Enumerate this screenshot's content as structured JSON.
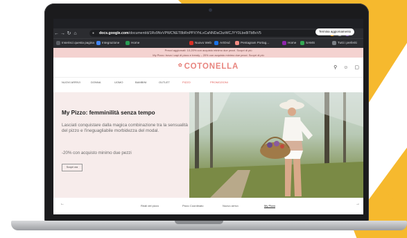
{
  "browser": {
    "url_domain": "docs.google.com",
    "url_rest": "/document/d/1Rv9NvVPWCNET8bRnPPXYhLxCaNNDaCbzWCJYY0Lbe8iTbBvV5",
    "update_button": "Termina aggiornamento",
    "bookmarks": [
      {
        "label": "Inserisci questa pagina",
        "color": "#5a5d63"
      },
      {
        "label": "Integrazione",
        "color": "#4285f4"
      },
      {
        "label": "Home",
        "color": "#2a9d54"
      },
      {
        "label": "Nuovo Web",
        "color": "#d93025"
      },
      {
        "label": "ArtOnd",
        "color": "#1a73e8"
      },
      {
        "label": "Pentagram Portag...",
        "color": "#f28b82"
      },
      {
        "label": "Home",
        "color": "#8e24aa"
      },
      {
        "label": "SAMS",
        "color": "#34a853"
      },
      {
        "label": "Tutti i preferiti",
        "color": "#7b7f85"
      }
    ]
  },
  "site": {
    "announcement_line1": "Prezzi aggiornati: 10-20% con acquisto minimo due pezzi. Scopri di più",
    "announcement_line2": "My Pizzo: trova i capi di pizzo e trendy – 20% con acquisto minimo due pezzi. Scopri di più",
    "logo": "COTONELLA",
    "menu": [
      "NUOVI ARRIVI",
      "DONNA",
      "UOMO",
      "BAMBINI",
      "OUTLET",
      "PIZZO",
      "PROMOZIONI"
    ],
    "hero": {
      "title": "My Pizzo: femminilità senza tempo",
      "description": "Lasciati conquistare dalla magica combinazione tra la sensualità del pizzo e l'ineguagliabile morbidezza del modal.",
      "promo": "-20% con acquisto minimo due pezzi",
      "button": "Scopri ora"
    },
    "bottom_nav": [
      "Reali del pizzo",
      "Pizzo Coordinato",
      "Nuovo arrivo",
      "My Pizzo"
    ]
  },
  "colors": {
    "brand": "#e8857f",
    "background_accent": "#f6b92e",
    "hero_panel": "#f7eceb",
    "announcement_bar": "#f4d2d0"
  }
}
